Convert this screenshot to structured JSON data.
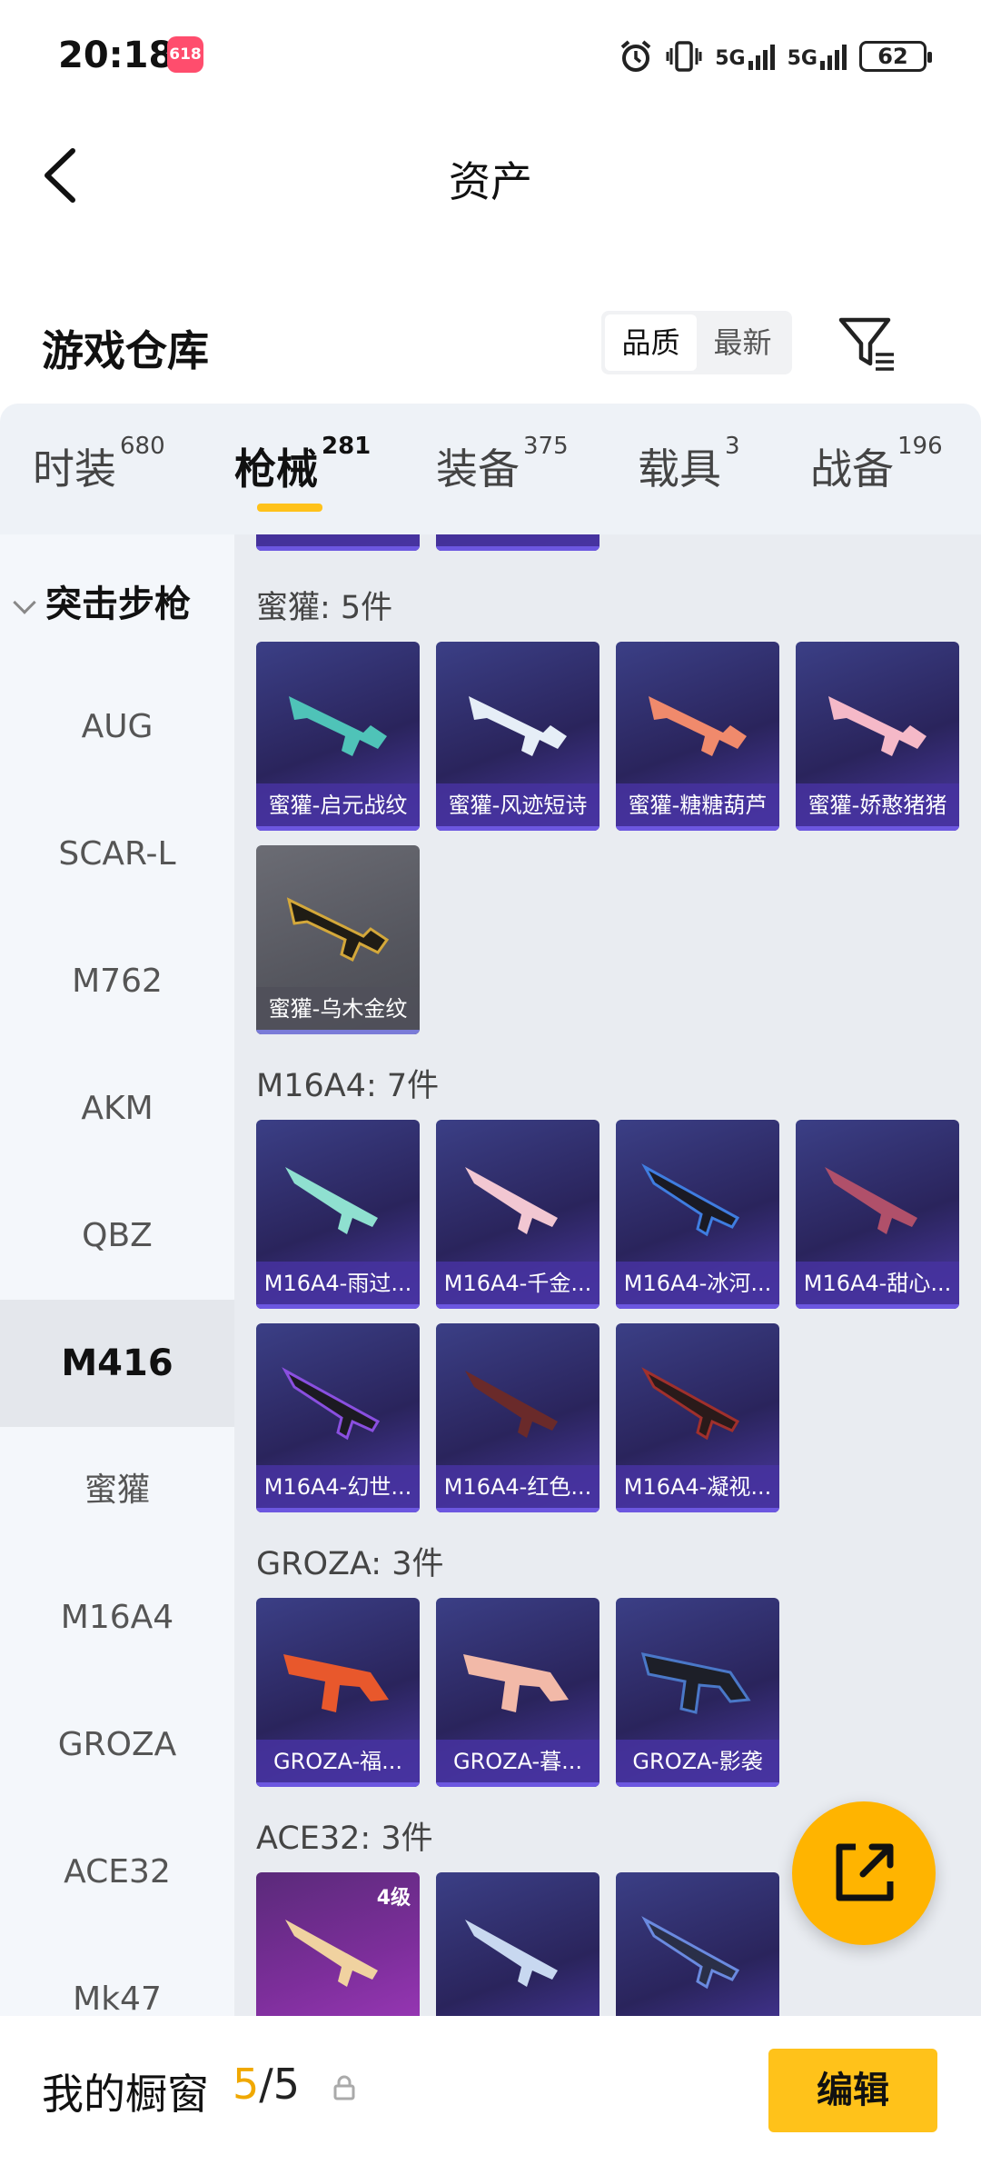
{
  "status_bar": {
    "time": "20:18",
    "app_badge": "618",
    "network1": "5G",
    "network2": "5G",
    "battery": "62"
  },
  "nav": {
    "title": "资产"
  },
  "warehouse": {
    "title": "游戏仓库",
    "sort_quality": "品质",
    "sort_newest": "最新"
  },
  "tabs": [
    {
      "label": "时装",
      "count": "680"
    },
    {
      "label": "枪械",
      "count": "281"
    },
    {
      "label": "装备",
      "count": "375"
    },
    {
      "label": "载具",
      "count": "3"
    },
    {
      "label": "战备",
      "count": "196"
    }
  ],
  "sidebar": {
    "header": "突击步枪",
    "items": [
      "AUG",
      "SCAR-L",
      "M762",
      "AKM",
      "QBZ",
      "M416",
      "蜜獾",
      "M16A4",
      "GROZA",
      "ACE32",
      "Mk47"
    ],
    "active": "M416"
  },
  "groups": [
    {
      "title": "蜜獾: 5件",
      "items": [
        "蜜獾-启元战纹",
        "蜜獾-风迹短诗",
        "蜜獾-糖糖葫芦",
        "蜜獾-娇憨猪猪",
        "蜜獾-乌木金纹"
      ]
    },
    {
      "title": "M16A4: 7件",
      "items": [
        "M16A4-雨过...",
        "M16A4-千金...",
        "M16A4-冰河...",
        "M16A4-甜心...",
        "M16A4-幻世...",
        "M16A4-红色...",
        "M16A4-凝视..."
      ]
    },
    {
      "title": "GROZA: 3件",
      "items": [
        "GROZA-福...",
        "GROZA-暮...",
        "GROZA-影袭"
      ]
    },
    {
      "title": "ACE32: 3件",
      "badge": "4级"
    }
  ],
  "bottom": {
    "title": "我的橱窗",
    "current": "5",
    "sep": "/",
    "total": "5",
    "edit": "编辑"
  },
  "colors": {
    "accent": "#ffc21a",
    "fab": "#ffb400",
    "count_highlight": "#f0a800",
    "card_purple": "#2a245c"
  },
  "icons": {
    "back": "back-arrow-icon",
    "filter": "filter-icon",
    "share": "share-out-icon",
    "lock": "lock-icon"
  }
}
